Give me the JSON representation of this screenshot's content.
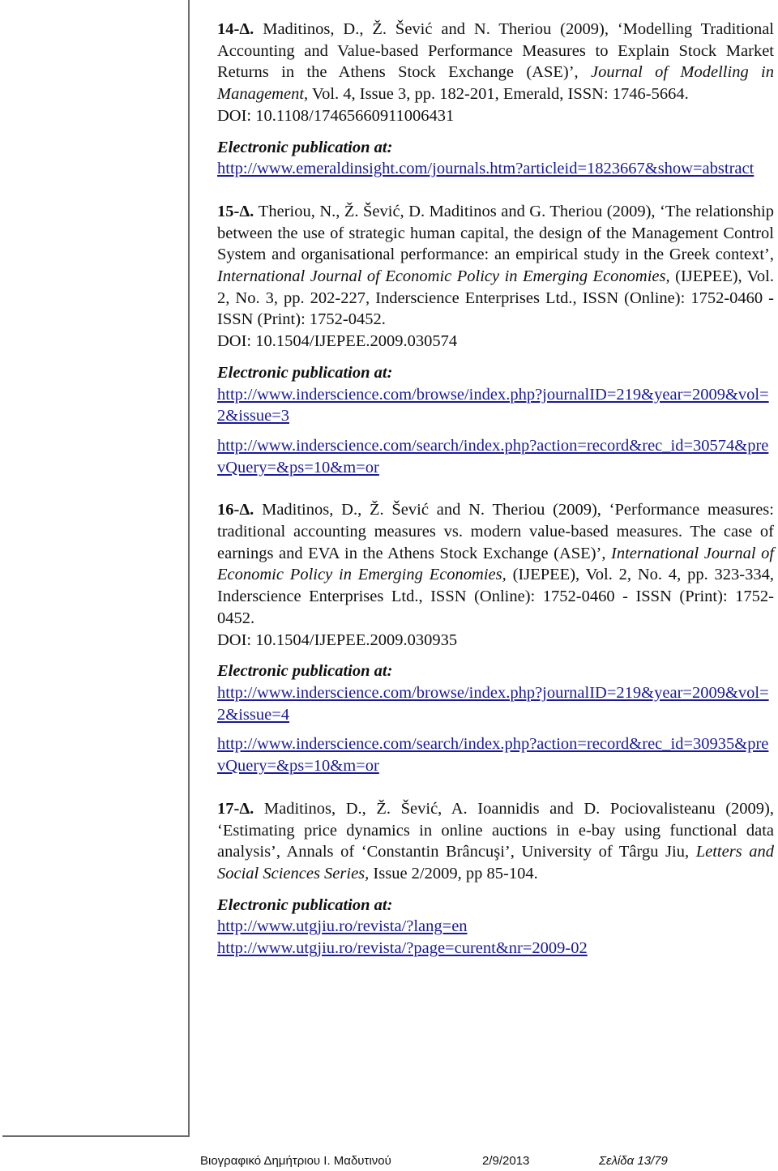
{
  "entries": [
    {
      "number": "14-Δ.",
      "citation_pre": " Maditinos, D., Ž. Šević and N. Theriou (2009), ‘Modelling Traditional Accounting and Value-based Performance Measures to Explain Stock Market Returns in the Athens Stock Exchange (ASE)’, ",
      "journal": "Journal of Modelling in Management,",
      "citation_post": " Vol. 4, Issue 3, pp. 182-201, Emerald, ISSN: 1746-5664.",
      "doi": "DOI: 10.1108/17465660911006431",
      "epub_label": "Electronic publication at:",
      "links": [
        "http://www.emeraldinsight.com/journals.htm?articleid=1823667&show=abstract"
      ]
    },
    {
      "number": "15-Δ.",
      "citation_pre": " Theriou, N., Ž. Šević, D. Maditinos and G. Theriou (2009), ‘The relationship between the use of strategic human capital, the design of the Management Control System and organisational performance: an empirical study in the Greek context’, ",
      "journal": "International Journal of Economic Policy in Emerging Economies,",
      "citation_post": " (IJEPEE), Vol. 2, No. 3, pp. 202-227, Inderscience Enterprises Ltd., ISSN (Online): 1752-0460 - ISSN (Print): 1752-0452.",
      "doi": "DOI: 10.1504/IJEPEE.2009.030574",
      "epub_label": "Electronic publication at:",
      "links": [
        "http://www.inderscience.com/browse/index.php?journalID=219&year=2009&vol=2&issue=3",
        "http://www.inderscience.com/search/index.php?action=record&rec_id=30574&prevQuery=&ps=10&m=or"
      ]
    },
    {
      "number": "16-Δ.",
      "citation_pre": " Maditinos, D., Ž. Šević and N. Theriou (2009), ‘Performance measures: traditional accounting measures vs. modern value-based measures. The case of earnings and EVA in the Athens Stock Exchange (ASE)’, ",
      "journal": "International Journal of Economic Policy in Emerging Economies,",
      "citation_post": " (IJEPEE), Vol. 2, No. 4, pp. 323-334, Inderscience Enterprises Ltd., ISSN (Online): 1752-0460 - ISSN (Print): 1752-0452.",
      "doi": "DOI: 10.1504/IJEPEE.2009.030935",
      "epub_label": "Electronic publication at:",
      "links": [
        "http://www.inderscience.com/browse/index.php?journalID=219&year=2009&vol=2&issue=4",
        "http://www.inderscience.com/search/index.php?action=record&rec_id=30935&prevQuery=&ps=10&m=or"
      ]
    },
    {
      "number": "17-Δ.",
      "citation_pre": " Maditinos, D., Ž. Šević, A. Ioannidis and D. Pociovalisteanu (2009), ‘Estimating price dynamics in online auctions in e-bay using functional data analysis’, Annals of ‘Constantin Brâncuşi’, University of Târgu Jiu, ",
      "journal": "Letters and Social Sciences Series,",
      "citation_post": " Issue 2/2009, pp 85-104.",
      "epub_label": "Electronic publication at:",
      "links": [
        "http://www.utgjiu.ro/revista/?lang=en",
        "http://www.utgjiu.ro/revista/?page=curent&nr=2009-02"
      ]
    }
  ],
  "footer": {
    "title": "Βιογραφικό Δημήτριου Ι. Μαδυτινού",
    "date": "2/9/2013",
    "page": "Σελίδα 13/79"
  },
  "colors": {
    "link": "#1a1a9c",
    "text": "#111111",
    "margin_line": "#6b6b6b"
  }
}
